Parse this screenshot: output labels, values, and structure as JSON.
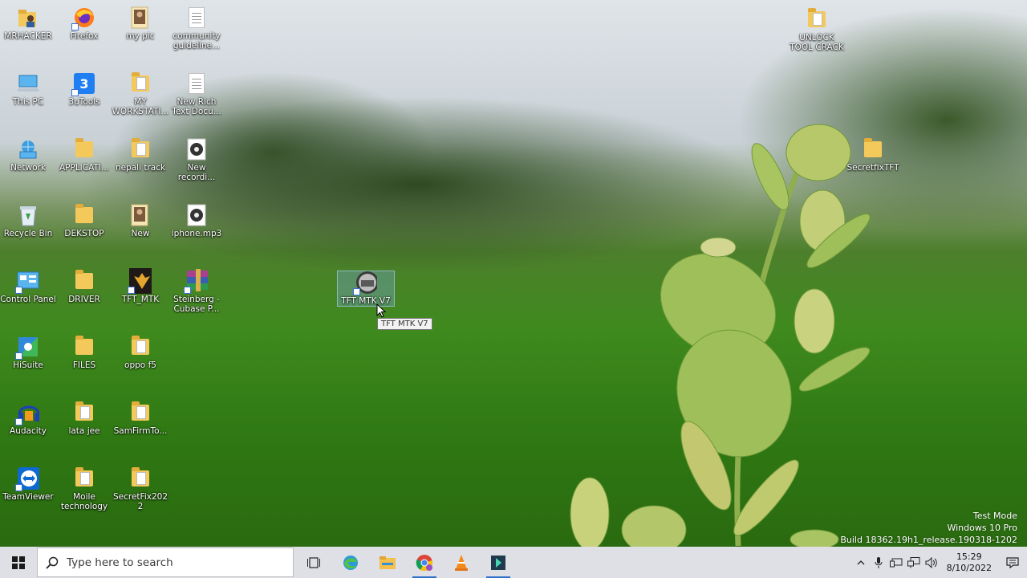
{
  "desktop_icons": [
    {
      "label": "MRHACKER",
      "kind": "user-folder"
    },
    {
      "label": "Firefox",
      "kind": "firefox"
    },
    {
      "label": "my pic",
      "kind": "photo"
    },
    {
      "label": "community guideline...",
      "kind": "file"
    },
    {
      "label": "This PC",
      "kind": "computer"
    },
    {
      "label": "3uTools",
      "kind": "app-blue"
    },
    {
      "label": "MY WORKSTATI...",
      "kind": "doc-folder"
    },
    {
      "label": "New Rich Text Docu...",
      "kind": "file"
    },
    {
      "label": "Network",
      "kind": "network"
    },
    {
      "label": "APPLICATI...",
      "kind": "folder"
    },
    {
      "label": "nepali track",
      "kind": "media-folder"
    },
    {
      "label": "New recordi...",
      "kind": "audio"
    },
    {
      "label": "Recycle Bin",
      "kind": "recycle"
    },
    {
      "label": "DEKSTOP",
      "kind": "folder"
    },
    {
      "label": "New",
      "kind": "photo"
    },
    {
      "label": "iphone.mp3",
      "kind": "audio"
    },
    {
      "label": "Control Panel",
      "kind": "control"
    },
    {
      "label": "DRIVER",
      "kind": "folder"
    },
    {
      "label": "TFT_MTK",
      "kind": "app-gold"
    },
    {
      "label": "Steinberg - Cubase P...",
      "kind": "winrar"
    },
    {
      "label": "HiSuite",
      "kind": "hisuite"
    },
    {
      "label": "FILES",
      "kind": "folder"
    },
    {
      "label": "oppo f5",
      "kind": "doc-folder"
    },
    {
      "label": "Audacity",
      "kind": "audacity"
    },
    {
      "label": "lata jee",
      "kind": "media-folder"
    },
    {
      "label": "SamFirmTo...",
      "kind": "doc-folder"
    },
    {
      "label": "TeamViewer",
      "kind": "teamviewer"
    },
    {
      "label": "Moile technology",
      "kind": "doc-folder"
    },
    {
      "label": "SecretFix2022",
      "kind": "doc-folder"
    },
    {
      "label": "TFT MTK V7",
      "kind": "tft"
    },
    {
      "label": "UNLOCK TOOL CRACK",
      "kind": "doc-folder"
    },
    {
      "label": "SecretfixTFT",
      "kind": "folder"
    }
  ],
  "tooltip": "TFT MTK V7",
  "watermark": {
    "line1": "Test Mode",
    "line2": "Windows 10 Pro",
    "line3": "Build 18362.19h1_release.190318-1202"
  },
  "taskbar": {
    "search_placeholder": "Type here to search",
    "clock_time": "15:29",
    "clock_date": "8/10/2022"
  },
  "colors": {
    "taskbar": "#dfe0e6",
    "accent": "#2f6fc9"
  }
}
